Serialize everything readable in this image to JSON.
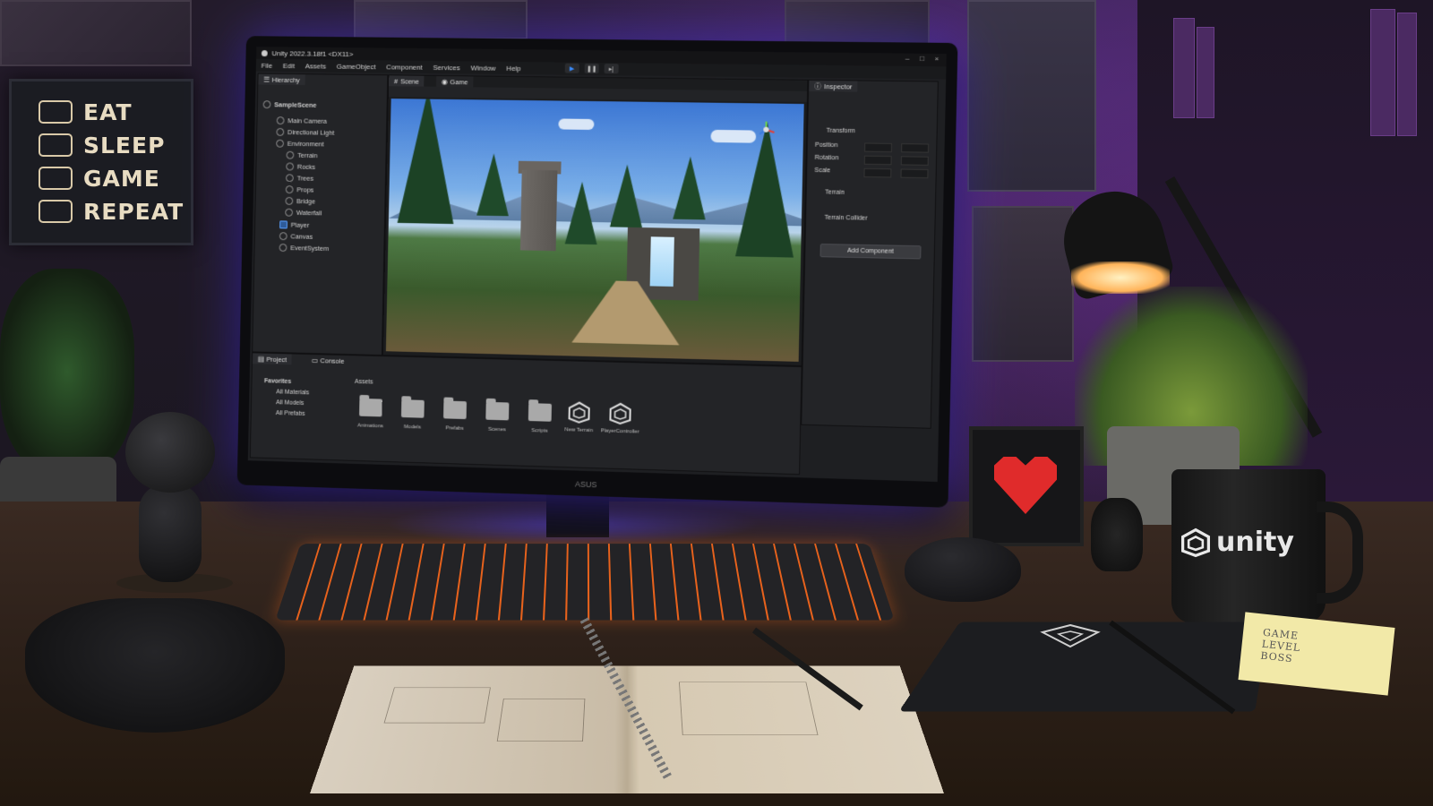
{
  "wall_sign": {
    "lines": [
      {
        "text": "EAT",
        "icon": "burger-icon"
      },
      {
        "text": "SLEEP",
        "icon": "bed-icon"
      },
      {
        "text": "GAME",
        "icon": "gamepad-icon"
      },
      {
        "text": "REPEAT",
        "icon": "repeat-icon"
      }
    ]
  },
  "unity": {
    "window_title": "Unity 2022.3.18f1 <DX11>",
    "menu": [
      "File",
      "Edit",
      "Assets",
      "GameObject",
      "Component",
      "Services",
      "Window",
      "Help"
    ],
    "tabs": {
      "hierarchy": "Hierarchy",
      "scene": "Scene",
      "game": "Game",
      "inspector": "Inspector",
      "project": "Project",
      "console": "Console"
    },
    "hierarchy": {
      "scene_name": "SampleScene",
      "items": [
        "Main Camera",
        "Directional Light",
        "Environment",
        "Terrain",
        "Rocks",
        "Trees",
        "Props",
        "Bridge",
        "Waterfall",
        "Player",
        "Canvas",
        "EventSystem"
      ]
    },
    "inspector": {
      "component_transform": "Transform",
      "position_label": "Position",
      "rotation_label": "Rotation",
      "scale_label": "Scale",
      "component_terrain": "Terrain",
      "component_terrain_collider": "Terrain Collider",
      "add_component": "Add Component"
    },
    "project": {
      "favorites": "Favorites",
      "favorite_items": [
        "All Materials",
        "All Models",
        "All Prefabs"
      ],
      "assets_header": "Assets",
      "assets": [
        "Animations",
        "Models",
        "Prefabs",
        "Scenes",
        "Scripts",
        "New Terrain",
        "PlayerController"
      ]
    }
  },
  "mug": {
    "logo_text": "unity"
  },
  "sticky_note": {
    "lines": [
      "GAME",
      "LEVEL",
      "BOSS"
    ]
  },
  "colors": {
    "accent_glow": "#5a46ff",
    "keyboard_backlight": "#e8621c",
    "heart": "#e02b2b"
  }
}
